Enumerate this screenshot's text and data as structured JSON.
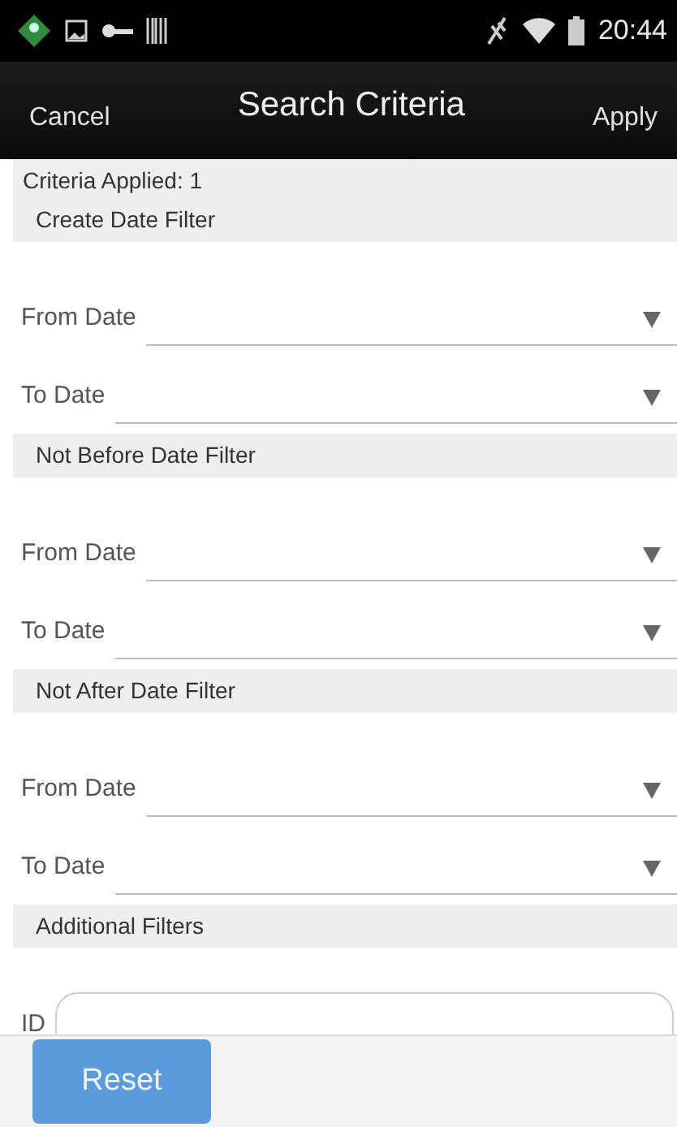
{
  "status_bar": {
    "time": "20:44"
  },
  "header": {
    "left": "Cancel",
    "title": "Search Criteria",
    "right": "Apply"
  },
  "criteria_applied": "Criteria Applied: 1",
  "sections": [
    {
      "title": "Create Date Filter",
      "fields": [
        {
          "label": "From Date",
          "kind": "dropdown"
        },
        {
          "label": "To Date",
          "kind": "dropdown"
        }
      ]
    },
    {
      "title": "Not Before Date Filter",
      "fields": [
        {
          "label": "From Date",
          "kind": "dropdown"
        },
        {
          "label": "To Date",
          "kind": "dropdown"
        }
      ]
    },
    {
      "title": "Not After Date Filter",
      "fields": [
        {
          "label": "From Date",
          "kind": "dropdown"
        },
        {
          "label": "To Date",
          "kind": "dropdown"
        }
      ]
    },
    {
      "title": "Additional Filters",
      "fields": [
        {
          "label": "ID",
          "kind": "text"
        }
      ]
    }
  ],
  "footer": {
    "button": "Reset"
  }
}
